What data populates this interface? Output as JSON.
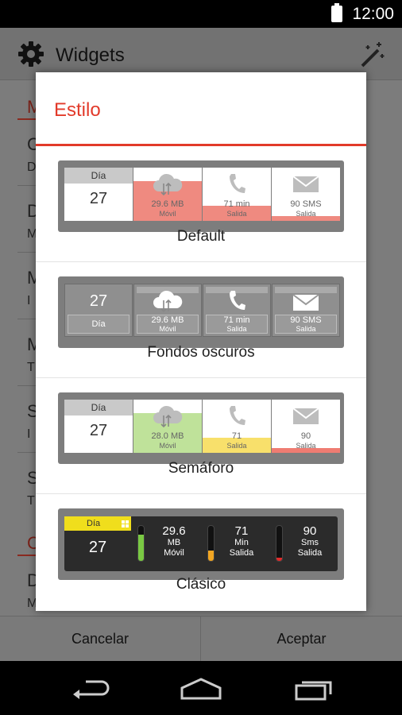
{
  "status_bar": {
    "time": "12:00"
  },
  "app_bar": {
    "title": "Widgets"
  },
  "background_list": {
    "letters": [
      "M",
      "C",
      "D",
      "D",
      "M",
      "M",
      "I",
      "M",
      "T",
      "S",
      "I",
      "S",
      "T",
      "C",
      "D",
      "M"
    ]
  },
  "buttons": {
    "cancel": "Cancelar",
    "accept": "Aceptar"
  },
  "dialog": {
    "title": "Estilo",
    "accent_color": "#e23a2a",
    "options": [
      {
        "label": "Default",
        "day_label": "Día",
        "day_number": "27",
        "data": {
          "value": "29.6 MB",
          "caption": "Móvil",
          "fill_percent": 75,
          "color": "#ef8a80"
        },
        "calls": {
          "value": "71 min",
          "caption": "Salida",
          "fill_percent": 28,
          "color": "#ef8a80"
        },
        "sms": {
          "value": "90 SMS",
          "caption": "Salida",
          "fill_percent": 9,
          "color": "#ef8a80"
        }
      },
      {
        "label": "Fondos oscuros",
        "day_label": "Día",
        "day_number": "27",
        "data": {
          "value": "29.6 MB",
          "caption": "Móvil"
        },
        "calls": {
          "value": "71 min",
          "caption": "Salida"
        },
        "sms": {
          "value": "90 SMS",
          "caption": "Salida"
        }
      },
      {
        "label": "Semáforo",
        "day_label": "Día",
        "day_number": "27",
        "data": {
          "value": "28.0 MB",
          "caption": "Móvil",
          "fill_percent": 75,
          "color": "#bfe29a"
        },
        "calls": {
          "value": "71",
          "caption": "Salida",
          "fill_percent": 28,
          "color": "#f8e06b"
        },
        "sms": {
          "value": "90",
          "caption": "Salida",
          "fill_percent": 9,
          "color": "#ef7c72"
        }
      },
      {
        "label": "Clásico",
        "day_label": "Día",
        "day_number": "27",
        "data": {
          "value": "29.6",
          "unit": "MB",
          "caption": "Móvil",
          "fill_percent": 75,
          "color": "#7ac943"
        },
        "calls": {
          "value": "71",
          "unit": "Min",
          "caption": "Salida",
          "fill_percent": 30,
          "color": "#f2a623"
        },
        "sms": {
          "value": "90",
          "unit": "Sms",
          "caption": "Salida",
          "fill_percent": 10,
          "color": "#e22b2b"
        }
      }
    ]
  }
}
